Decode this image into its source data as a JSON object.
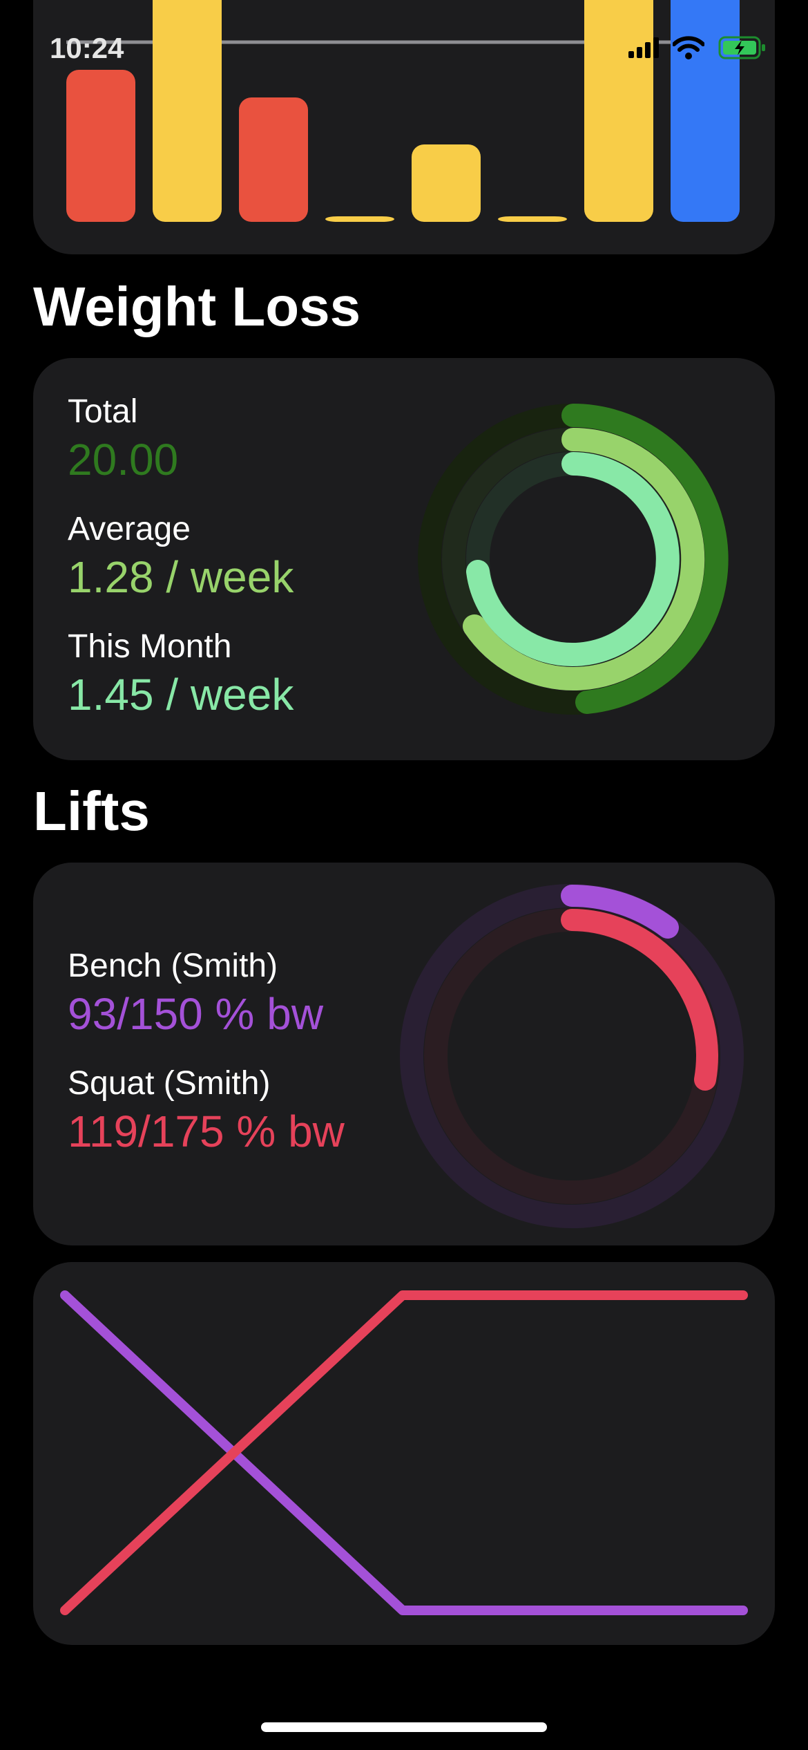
{
  "status_bar": {
    "time": "10:24"
  },
  "activity_chart": {
    "bars": [
      {
        "value": 0.55,
        "color": "#e9523f"
      },
      {
        "value": 1.0,
        "color": "#f8cd48"
      },
      {
        "value": 0.45,
        "color": "#e9523f"
      },
      {
        "value": 0.02,
        "color": "#f8cd48"
      },
      {
        "value": 0.28,
        "color": "#f8cd48"
      },
      {
        "value": 0.02,
        "color": "#f8cd48"
      },
      {
        "value": 1.0,
        "color": "#f8cd48"
      },
      {
        "value": 1.0,
        "color": "#3478f6"
      }
    ]
  },
  "weight_loss": {
    "title": "Weight Loss",
    "total_label": "Total",
    "total_value": "20.00",
    "average_label": "Average",
    "average_value": "1.28 / week",
    "month_label": "This Month",
    "month_value": "1.45 / week",
    "colors": {
      "total": "#2f7a1f",
      "average": "#98d36b",
      "month": "#88e8a7"
    }
  },
  "lifts": {
    "title": "Lifts",
    "bench_label": "Bench (Smith)",
    "bench_value": "93/150 % bw",
    "squat_label": "Squat (Smith)",
    "squat_value": "119/175 % bw",
    "colors": {
      "bench": "#a451d8",
      "squat": "#e6425a"
    }
  }
}
